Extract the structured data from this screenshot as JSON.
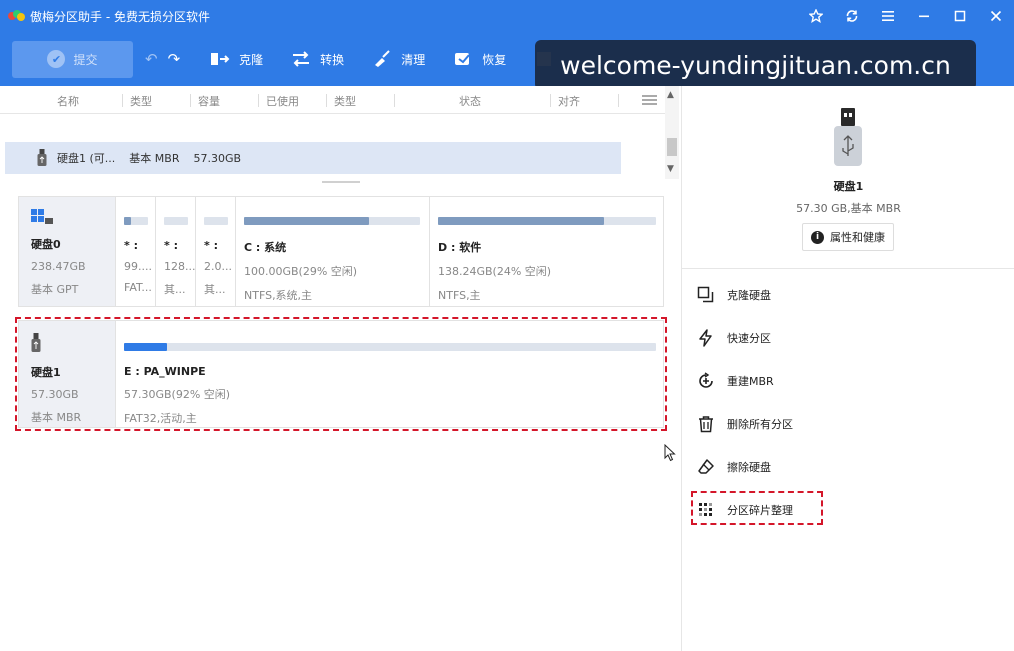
{
  "app": {
    "title": "傲梅分区助手 - 免费无损分区软件"
  },
  "watermark": "welcome-yundingjituan.com.cn",
  "toolbar": {
    "submit_label": "提交",
    "tools": [
      {
        "label": "克隆",
        "icon": "clone-icon"
      },
      {
        "label": "转换",
        "icon": "convert-icon"
      },
      {
        "label": "清理",
        "icon": "clean-icon"
      },
      {
        "label": "恢复",
        "icon": "restore-icon"
      }
    ]
  },
  "columns": [
    "名称",
    "类型",
    "容量",
    "已使用",
    "类型",
    "状态",
    "对齐"
  ],
  "disk_row": {
    "name": "硬盘1 (可...",
    "type": "基本 MBR",
    "capacity": "57.30GB"
  },
  "disk0": {
    "name": "硬盘0",
    "size": "238.47GB",
    "type": "基本 GPT",
    "partitions": [
      {
        "label": "* :",
        "info": "99....",
        "fs": "FAT...",
        "fill": 0.3
      },
      {
        "label": "* :",
        "info": "128....",
        "fs": "其...",
        "fill": 0.0
      },
      {
        "label": "* :",
        "info": "2.0...",
        "fs": "其...",
        "fill": 0.0
      },
      {
        "label": "C : 系统",
        "info": "100.00GB(29% 空闲)",
        "fs": "NTFS,系统,主",
        "fill": 0.71
      },
      {
        "label": "D : 软件",
        "info": "138.24GB(24% 空闲)",
        "fs": "NTFS,主",
        "fill": 0.76
      }
    ]
  },
  "disk1": {
    "name": "硬盘1",
    "size": "57.30GB",
    "type": "基本 MBR",
    "partitions": [
      {
        "label": "E : PA_WINPE",
        "info": "57.30GB(92% 空闲)",
        "fs": "FAT32,活动,主",
        "fill": 0.08
      }
    ]
  },
  "right_panel": {
    "disk_name": "硬盘1",
    "disk_sub": "57.30 GB,基本 MBR",
    "props_label": "属性和健康",
    "operations": [
      {
        "label": "克隆硬盘",
        "icon": "clone-disk-icon"
      },
      {
        "label": "快速分区",
        "icon": "lightning-icon"
      },
      {
        "label": "重建MBR",
        "icon": "rebuild-mbr-icon"
      },
      {
        "label": "删除所有分区",
        "icon": "trash-icon"
      },
      {
        "label": "擦除硬盘",
        "icon": "eraser-icon"
      },
      {
        "label": "分区碎片整理",
        "icon": "defrag-icon"
      }
    ]
  },
  "colors": {
    "accent": "#2f7be6",
    "highlight": "#d4162a",
    "bar_used": "#7f9bbf",
    "bar_selected": "#2f7be6"
  }
}
